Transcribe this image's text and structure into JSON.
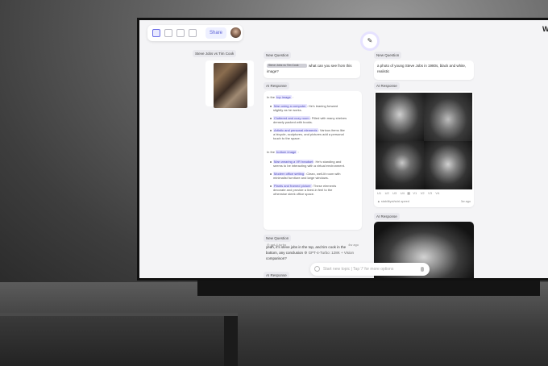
{
  "toolbar": {
    "share_label": "Share"
  },
  "corner_text": "W",
  "left_thread": {
    "title": "Steve Jobs vs Tim Cook"
  },
  "middle": {
    "new_question_label": "New Question",
    "q1_chip": "Steve Jobs vs Tim Cook",
    "q1_text": "what can you see from this",
    "q1_text2": "image?",
    "ai_response_label": "AI Response",
    "top_intro_pre": "In the",
    "top_intro_hl": "top image",
    "items_top": [
      {
        "hl": "Man using a computer",
        "text": ": He's leaning forward",
        "text2": "slightly as he works."
      },
      {
        "hl": "Cluttered and cozy room",
        "text": ": Filled with many shelves",
        "text2": "densely packed with books."
      },
      {
        "hl": "Artistic and personal elements",
        "text": ": Various items like",
        "text2": "a bicycle, sculptures, and pictures add a personal",
        "text3": "touch to the space."
      }
    ],
    "bottom_intro_pre": "In the",
    "bottom_intro_hl": "bottom image",
    "items_bottom": [
      {
        "hl": "Man wearing a VR headset",
        "text": ": He's standing and",
        "text2": "seems to be interacting with a virtual environment."
      },
      {
        "hl": "Modern office setting",
        "text": ": Clean, well-lit room with",
        "text2": "minimalist furniture and large windows."
      },
      {
        "hl": "Plants and framed picture",
        "text": ": These elements",
        "text2": "decorate and provide a lived-in feel to the",
        "text3": "otherwise sleek office space."
      }
    ],
    "model": "gpt-4-turbo",
    "time": "4w ago",
    "q2_label": "New Question",
    "q2_text": "yeah, it's steve jobs in the top, and tim cook in the",
    "q2_text2": "bottom, any conclusion",
    "q2_tooltip": "GPT-4-Turbo: 128K + Vision",
    "q2_text3": "comparison?",
    "ai_response2_label": "AI Response"
  },
  "right": {
    "new_question_label": "New Question",
    "q_text": "a photo of young Steve Jobs in 1980s, black and white,",
    "q_text2": "realistic",
    "ai_response_label": "AI Response",
    "variant_tabs": [
      "U1",
      "U2",
      "U3",
      "U4",
      "V1",
      "V2",
      "V3",
      "V4"
    ],
    "source": "stabilityai/sdxl-speed",
    "time": "3w ago",
    "ai_response2_label": "AI Response"
  },
  "prompt": {
    "placeholder": "Start new topic | Tap '/' for more options"
  }
}
